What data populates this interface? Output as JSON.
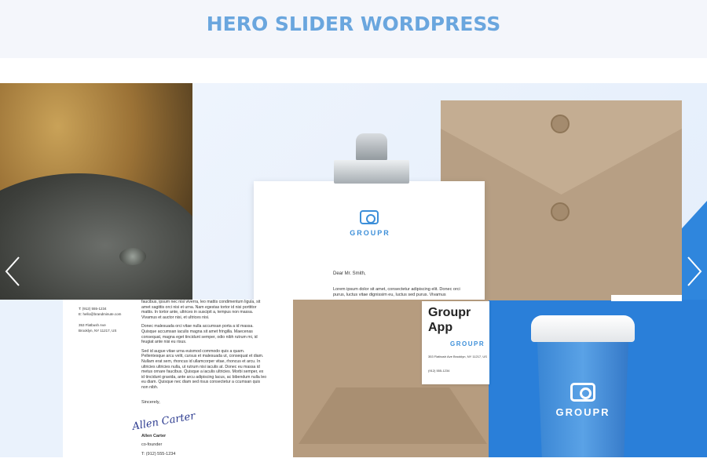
{
  "header": {
    "title": "HERO SLIDER WORDPRESS"
  },
  "slider": {
    "prev_label": "‹",
    "next_label": "›",
    "letterhead": {
      "brand": "GROUPR",
      "greeting": "Dear Mr. Smith,",
      "snippet": "Lorem ipsum dolor sit amet, consectetur adipiscing elit. Donec orci purus, luctus vitae dignissim eu, luctus sed purus. Vivamus"
    },
    "letter_sheet": {
      "contacts": [
        "T: (912) 555-1234",
        "E: hello@brandminute.com",
        "",
        "353 Flatbush Ave",
        "Brooklyn, NY 11217, US"
      ],
      "paragraphs": [
        "faucibus, ipsum nec nisi viverra, leo mattis condimentum ligula, sit amet sagittis orci nisi et urna. Nam egestas tortor id nisi porttitor mattis. In tortor ante, ultrices in suscipit a, tempus non massa. Vivamus et auctor nisi, et ultrices nisi.",
        "Donec malesuada orci vitae nulla accumsan porta a id massa. Quisque accumsan iaculis magna sit amet fringilla. Maecenas consequat, magna eget tincidunt semper, odio nibh rutrum mi, id feugiat ante nisi eu risus.",
        "Sed id augue vitae urna euismod commodo quis a quam. Pellentesque arcu velit, cursus et malesuada ut, consequat et diam. Nullam erat sem, rhoncus id ullamcorper vitae, rhoncus et arcu. In ultricies ultricies nulla, ut rutrum nisi iaculis at. Donec eu massa id metus ornare faucibus. Quisque a iaculis ultricies. Morbi semper, ex id tincidunt gravida, ante arcu adipiscing lacus, ac bibendum nulla leo eu diam. Quisque nec diam sed risus consectetur a ccumsan quis non nibh."
      ],
      "closing": "Sincerely,",
      "signature": "Allen Carter",
      "name": "Allen Carter",
      "role": "co-founder",
      "phone": "T: (912) 555-1234"
    },
    "business_card": {
      "title": "Groupr App",
      "brand": "GROUPR",
      "address": "353 Flatbush Ave Brooklyn, NY 11217, US",
      "phone": "(912) 555-1234"
    },
    "cup": {
      "brand": "GROUPR"
    }
  }
}
